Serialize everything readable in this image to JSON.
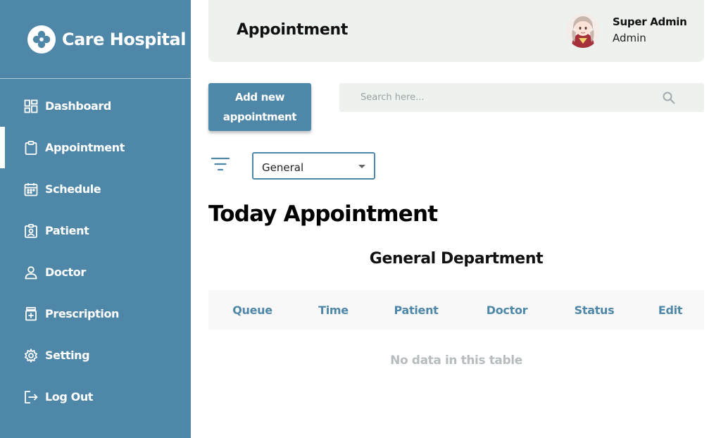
{
  "sidebar": {
    "brand": "Care Hospital",
    "items": [
      {
        "label": "Dashboard",
        "icon": "dashboard-icon",
        "active": false
      },
      {
        "label": "Appointment",
        "icon": "clipboard-icon",
        "active": true
      },
      {
        "label": "Schedule",
        "icon": "calendar-icon",
        "active": false
      },
      {
        "label": "Patient",
        "icon": "patient-badge-icon",
        "active": false
      },
      {
        "label": "Doctor",
        "icon": "person-icon",
        "active": false
      },
      {
        "label": "Prescription",
        "icon": "medicine-bottle-icon",
        "active": false
      },
      {
        "label": "Setting",
        "icon": "gear-icon",
        "active": false
      },
      {
        "label": "Log Out",
        "icon": "logout-icon",
        "active": false
      }
    ]
  },
  "header": {
    "title": "Appointment",
    "user": {
      "name": "Super Admin",
      "role": "Admin"
    }
  },
  "toolbar": {
    "add_label": "Add new appointment",
    "search_placeholder": "Search here...",
    "filter_value": "General"
  },
  "main": {
    "section_title": "Today Appointment",
    "department_title": "General Department",
    "table": {
      "columns": [
        "Queue",
        "Time",
        "Patient",
        "Doctor",
        "Status",
        "Edit"
      ],
      "rows": [],
      "empty_text": "No data in this table"
    }
  },
  "colors": {
    "primary": "#4f87a8",
    "header_bg": "#eef2ee",
    "table_header_bg": "#f7f8f7",
    "muted_text": "#b7bcbf"
  }
}
